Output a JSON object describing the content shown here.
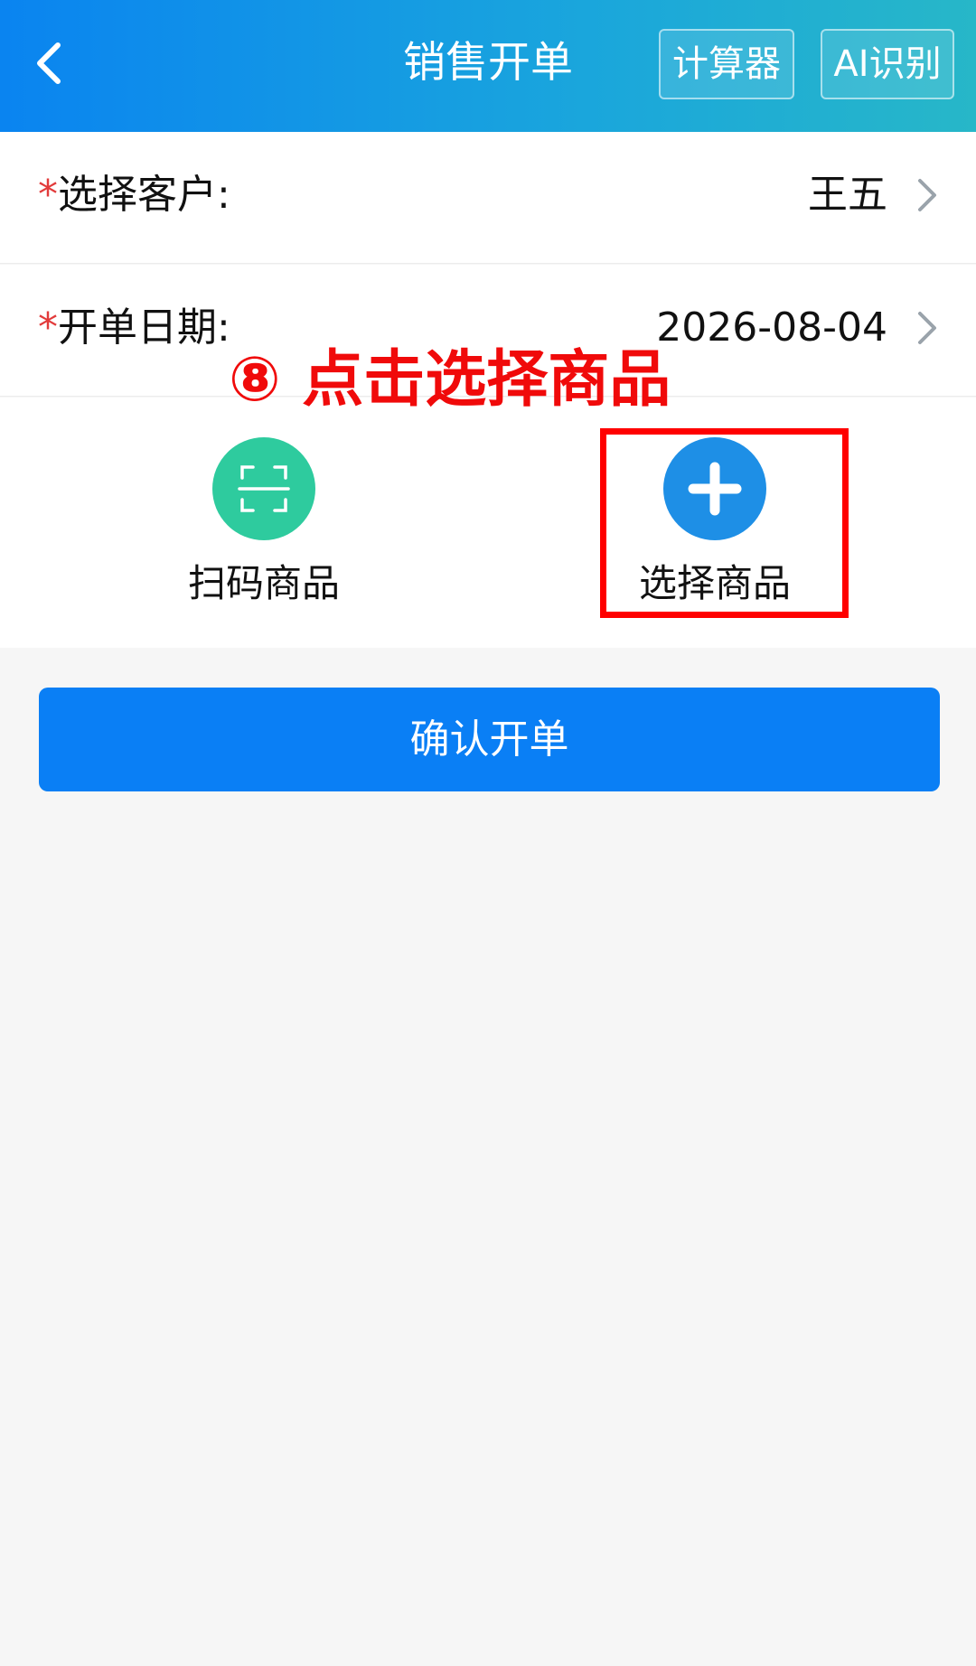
{
  "header": {
    "title": "销售开单",
    "calculator_label": "计算器",
    "ai_label": "AI识别"
  },
  "form": {
    "customer": {
      "required_mark": "*",
      "label": "选择客户:",
      "value": "王五"
    },
    "date": {
      "required_mark": "*",
      "label": "开单日期:",
      "value": "2026-08-04"
    }
  },
  "actions": {
    "scan_label": "扫码商品",
    "pick_label": "选择商品"
  },
  "annotation": {
    "text": "⑧ 点击选择商品",
    "color": "#ff0000"
  },
  "confirm_label": "确认开单",
  "colors": {
    "header_start": "#0a84f0",
    "header_end": "#27b7c8",
    "primary": "#0a7ff5",
    "scan_green": "#2ecb9e",
    "pick_blue": "#1e8fe6",
    "required_red": "#e23b3b"
  }
}
